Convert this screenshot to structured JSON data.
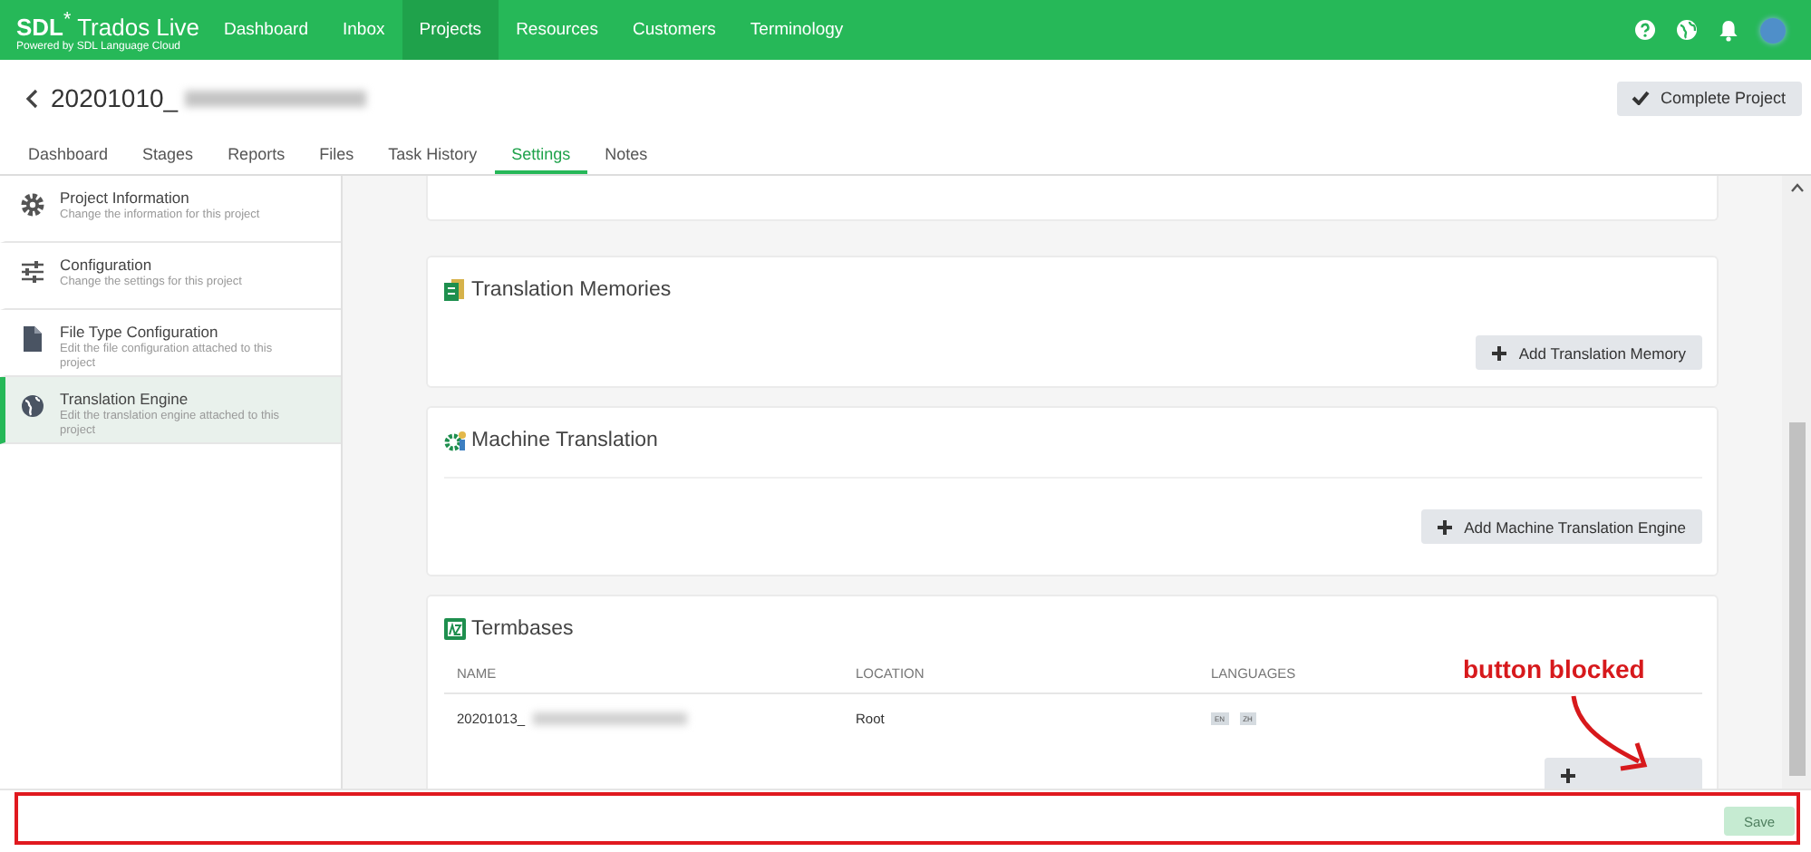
{
  "header": {
    "logo": "**SDL**$^{*}$ Trados Live",
    "tagline": "Powered by SDL Language Cloud",
    "nav": [
      {
        "label": "Dashboard",
        "selected": false
      },
      {
        "label": "Inbox",
        "selected": false
      },
      {
        "label": "Projects",
        "selected": true
      },
      {
        "label": "Resources",
        "selected": false
      },
      {
        "label": "Customers",
        "selected": false
      },
      {
        "label": "Terminology",
        "selected": false
      }
    ]
  },
  "project": {
    "title": "20201010_",
    "redacted": true,
    "action": "Complete Project"
  },
  "tabs": [
    {
      "label": "Dashboard",
      "selected": false
    },
    {
      "label": "Stages",
      "selected": false
    },
    {
      "label": "Reports",
      "selected": false
    },
    {
      "label": "Files",
      "selected": false
    },
    {
      "label": "Task History",
      "selected": false
    },
    {
      "label": "Settings",
      "selected": true
    },
    {
      "label": "Notes",
      "selected": false
    }
  ],
  "sidebar": {
    "items": [
      {
        "kind": "gear",
        "title": "Project Information",
        "description": "Change the information for this project",
        "selected": false
      },
      {
        "kind": "sliders",
        "title": "Configuration",
        "description": "Change the settings for this project",
        "selected": false
      },
      {
        "kind": "file",
        "title": "File Type Configuration",
        "description": "Edit the file configuration attached to this project",
        "selected": false
      },
      {
        "kind": "globe",
        "title": "Translation Engine",
        "description": "Edit the translation engine attached to this project",
        "selected": true
      }
    ]
  },
  "sections": [
    {
      "kind": "tm",
      "title": "Translation Memories",
      "button": "Add Translation Memory"
    },
    {
      "kind": "mt",
      "title": "Machine Translation",
      "button": "Add Machine Translation Engine"
    },
    {
      "kind": "termbases",
      "title": "Termbases",
      "columns": [
        "NAME",
        "LOCATION",
        "LANGUAGES"
      ],
      "rows": [
        {
          "name": "20201013_",
          "redacted": true,
          "location": "Root",
          "languages": [
            "EN",
            "ZH"
          ]
        }
      ]
    }
  ],
  "footer": {
    "save": {
      "label": "Save",
      "disabled": true
    }
  },
  "annotation": {
    "text": "button blocked"
  }
}
